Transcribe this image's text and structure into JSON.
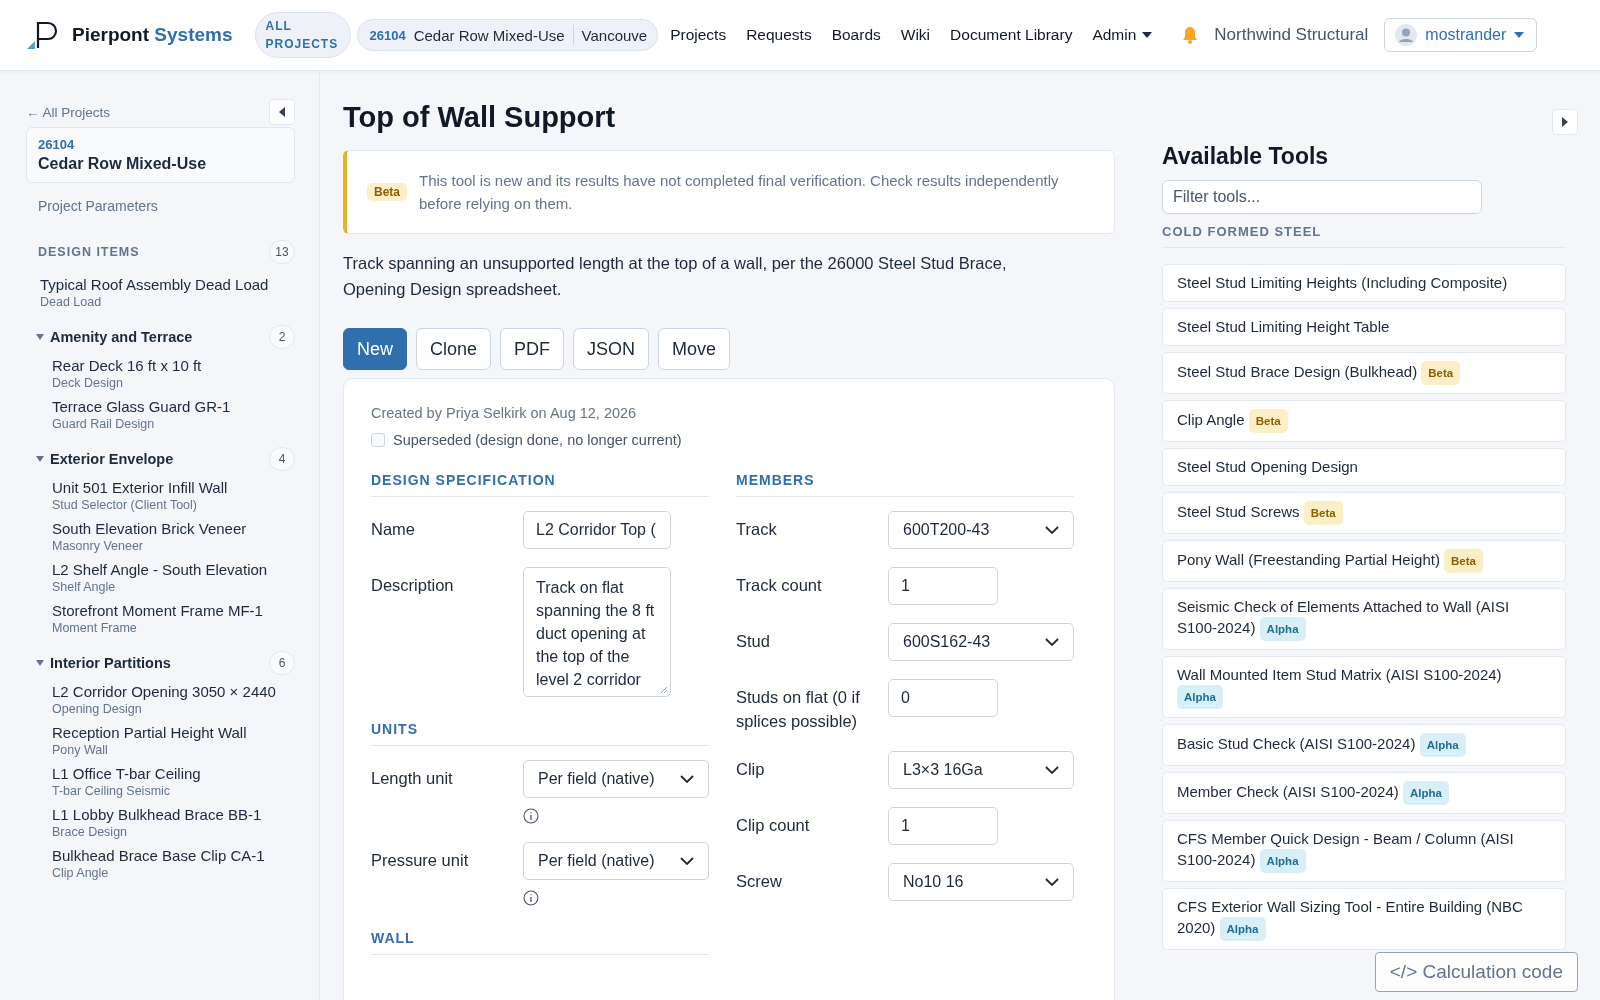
{
  "header": {
    "brand": {
      "name": "Pierpont",
      "accent": "Systems"
    },
    "all_projects": "ALL PROJECTS",
    "project_pill": {
      "number": "26104",
      "name": "Cedar Row Mixed-Use",
      "location": "Vancouve"
    },
    "nav": [
      {
        "label": "Projects"
      },
      {
        "label": "Requests"
      },
      {
        "label": "Boards"
      },
      {
        "label": "Wiki"
      },
      {
        "label": "Document Library"
      },
      {
        "label": "Admin",
        "dropdown": true
      }
    ],
    "org": "Northwind Structural",
    "user": "mostrander"
  },
  "sidebar": {
    "back": "← All Projects",
    "project": {
      "number": "26104",
      "name": "Cedar Row Mixed-Use"
    },
    "parameters": "Project Parameters",
    "design_items": {
      "title": "DESIGN ITEMS",
      "count": "13",
      "items": [
        {
          "title": "Typical Roof Assembly Dead Load",
          "subtitle": "Dead Load"
        }
      ],
      "groups": [
        {
          "title": "Amenity and Terrace",
          "count": "2",
          "expanded": true,
          "items": [
            {
              "title": "Rear Deck 16 ft x 10 ft",
              "subtitle": "Deck Design"
            },
            {
              "title": "Terrace Glass Guard GR-1",
              "subtitle": "Guard Rail Design"
            }
          ]
        },
        {
          "title": "Exterior Envelope",
          "count": "4",
          "expanded": true,
          "items": [
            {
              "title": "Unit 501 Exterior Infill Wall",
              "subtitle": "Stud Selector (Client Tool)"
            },
            {
              "title": "South Elevation Brick Veneer",
              "subtitle": "Masonry Veneer"
            },
            {
              "title": "L2 Shelf Angle - South Elevation",
              "subtitle": "Shelf Angle"
            },
            {
              "title": "Storefront Moment Frame MF-1",
              "subtitle": "Moment Frame"
            }
          ]
        },
        {
          "title": "Interior Partitions",
          "count": "6",
          "expanded": true,
          "items": [
            {
              "title": "L2 Corridor Opening 3050 × 2440",
              "subtitle": "Opening Design"
            },
            {
              "title": "Reception Partial Height Wall",
              "subtitle": "Pony Wall"
            },
            {
              "title": "L1 Office T-bar Ceiling",
              "subtitle": "T-bar Ceiling Seismic"
            },
            {
              "title": "L1 Lobby Bulkhead Brace BB-1",
              "subtitle": "Brace Design"
            },
            {
              "title": "Bulkhead Brace Base Clip CA-1",
              "subtitle": "Clip Angle"
            }
          ]
        }
      ]
    }
  },
  "main": {
    "title": "Top of Wall Support",
    "notice": {
      "badge": "Beta",
      "text": "This tool is new and its results have not completed final verification. Check results independently before relying on them."
    },
    "description": "Track spanning an unsupported length at the top of a wall, per the 26000 Steel Stud Brace, Opening Design spreadsheet.",
    "actions": [
      {
        "label": "New",
        "selected": true
      },
      {
        "label": "Clone",
        "selected": false
      },
      {
        "label": "PDF",
        "selected": false
      },
      {
        "label": "JSON",
        "selected": false
      },
      {
        "label": "Move",
        "selected": false
      }
    ],
    "record": {
      "created": "Created by Priya Selkirk on Aug 12, 2026",
      "superseded": {
        "label": "Superseded (design done, no longer current)",
        "checked": false
      }
    },
    "left_sections": [
      {
        "title": "DESIGN SPECIFICATION",
        "fields": [
          {
            "label": "Name",
            "kind": "text",
            "value": "L2 Corridor Top ("
          },
          {
            "label": "Description",
            "kind": "textarea",
            "value": "Track on flat spanning the 8 ft duct opening at the top of the level 2 corridor"
          }
        ]
      },
      {
        "title": "UNITS",
        "fields": [
          {
            "label": "Length unit",
            "kind": "select",
            "value": "Per field (native)",
            "info": true
          },
          {
            "label": "Pressure unit",
            "kind": "select",
            "value": "Per field (native)",
            "info": true
          }
        ]
      },
      {
        "title": "WALL"
      }
    ],
    "right_sections": [
      {
        "title": "MEMBERS",
        "fields": [
          {
            "label": "Track",
            "kind": "select",
            "value": "600T200-43"
          },
          {
            "label": "Track count",
            "kind": "number",
            "value": "1"
          },
          {
            "label": "Stud",
            "kind": "select",
            "value": "600S162-43"
          },
          {
            "label": "Studs on flat (0 if splices possible)",
            "kind": "number",
            "value": "0"
          },
          {
            "label": "Clip",
            "kind": "select",
            "value": "L3×3 16Ga"
          },
          {
            "label": "Clip count",
            "kind": "number",
            "value": "1"
          },
          {
            "label": "Screw",
            "kind": "select",
            "value": "No10 16"
          }
        ]
      }
    ]
  },
  "tools": {
    "title": "Available Tools",
    "filter_placeholder": "Filter tools...",
    "category": "COLD FORMED STEEL",
    "items": [
      {
        "label": "Steel Stud Limiting Heights (Including Composite)"
      },
      {
        "label": "Steel Stud Limiting Height Table"
      },
      {
        "label": "Steel Stud Brace Design (Bulkhead)",
        "badge": {
          "text": "Beta",
          "kind": "beta"
        }
      },
      {
        "label": "Clip Angle",
        "badge": {
          "text": "Beta",
          "kind": "beta"
        }
      },
      {
        "label": "Steel Stud Opening Design"
      },
      {
        "label": "Steel Stud Screws",
        "badge": {
          "text": "Beta",
          "kind": "beta"
        }
      },
      {
        "label": "Pony Wall (Freestanding Partial Height)",
        "badge": {
          "text": "Beta",
          "kind": "beta"
        }
      },
      {
        "label": "Seismic Check of Elements Attached to Wall (AISI S100-2024)",
        "badge": {
          "text": "Alpha",
          "kind": "alpha"
        }
      },
      {
        "label": "Wall Mounted Item Stud Matrix (AISI S100-2024)",
        "badge": {
          "text": "Alpha",
          "kind": "alpha"
        }
      },
      {
        "label": "Basic Stud Check (AISI S100-2024)",
        "badge": {
          "text": "Alpha",
          "kind": "alpha"
        }
      },
      {
        "label": "Member Check (AISI S100-2024)",
        "badge": {
          "text": "Alpha",
          "kind": "alpha"
        }
      },
      {
        "label": "CFS Member Quick Design - Beam / Column (AISI S100-2024)",
        "badge": {
          "text": "Alpha",
          "kind": "alpha"
        }
      },
      {
        "label": "CFS Exterior Wall Sizing Tool - Entire Building (NBC 2020)",
        "badge": {
          "text": "Alpha",
          "kind": "alpha"
        }
      }
    ],
    "calc_button": "</> Calculation code"
  }
}
